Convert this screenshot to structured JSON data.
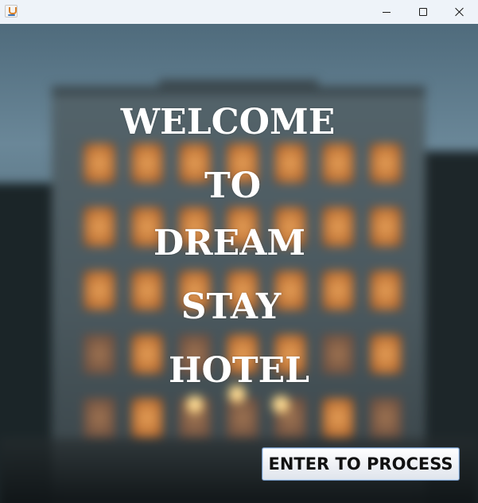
{
  "window": {
    "app_icon": "java-cup-icon",
    "controls": [
      "minimize-icon",
      "maximize-icon",
      "close-icon"
    ]
  },
  "welcome": {
    "line1": "WELCOME",
    "line2": "TO",
    "line3": "DREAM",
    "line4": "STAY",
    "line5": "HOTEL"
  },
  "button": {
    "enter_label": "ENTER TO PROCESS"
  },
  "colors": {
    "title_text": "#ffffff",
    "button_border": "#6c8fb9",
    "titlebar_bg": "#eef3f9"
  }
}
